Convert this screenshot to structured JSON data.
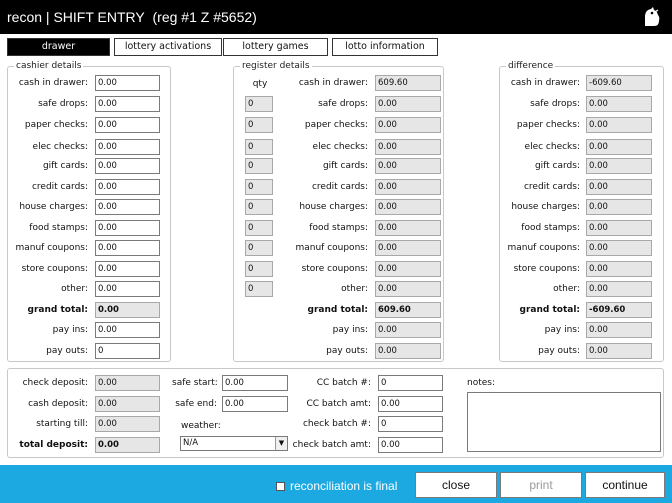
{
  "title": {
    "app": "recon",
    "sep": " | ",
    "screen": "SHIFT ENTRY",
    "reg": "(reg #1  Z #5652)",
    "logo_icon": "bird-logo"
  },
  "tabs": [
    "drawer",
    "lottery activations",
    "lottery games",
    "lotto information"
  ],
  "rows": [
    "cash in drawer:",
    "safe drops:",
    "paper checks:",
    "elec checks:",
    "gift cards:",
    "credit cards:",
    "house charges:",
    "food stamps:",
    "manuf coupons:",
    "store coupons:",
    "other:",
    "grand total:",
    "pay ins:",
    "pay outs:"
  ],
  "cashier": {
    "legend": "cashier details",
    "values": [
      "0.00",
      "0.00",
      "0.00",
      "0.00",
      "0.00",
      "0.00",
      "0.00",
      "0.00",
      "0.00",
      "0.00",
      "0.00",
      "0.00",
      "0.00",
      "0"
    ]
  },
  "register": {
    "legend": "register details",
    "qty_header": "qty",
    "qty": [
      "0",
      "0",
      "0",
      "0",
      "0",
      "0",
      "0",
      "0",
      "0",
      "0"
    ],
    "values": [
      "609.60",
      "0.00",
      "0.00",
      "0.00",
      "0.00",
      "0.00",
      "0.00",
      "0.00",
      "0.00",
      "0.00",
      "0.00",
      "609.60",
      "0.00",
      "0.00"
    ]
  },
  "difference": {
    "legend": "difference",
    "values": [
      "-609.60",
      "0.00",
      "0.00",
      "0.00",
      "0.00",
      "0.00",
      "0.00",
      "0.00",
      "0.00",
      "0.00",
      "0.00",
      "-609.60",
      "0.00",
      "0.00"
    ]
  },
  "bottom": {
    "deposit_labels": [
      "check deposit:",
      "cash deposit:",
      "starting till:",
      "total deposit:"
    ],
    "deposit_values": [
      "0.00",
      "0.00",
      "0.00",
      "0.00"
    ],
    "safe_start_label": "safe start:",
    "safe_start_value": "0.00",
    "safe_end_label": "safe end:",
    "safe_end_value": "0.00",
    "weather_label": "weather:",
    "weather_value": "N/A",
    "batch_labels": [
      "CC batch #:",
      "CC batch amt:",
      "check batch #:",
      "check batch amt:"
    ],
    "batch_values": [
      "0",
      "0.00",
      "0",
      "0.00"
    ],
    "notes_label": "notes:"
  },
  "footer": {
    "final_label": "reconciliation is final",
    "close": "close",
    "print": "print",
    "continue": "continue"
  },
  "colors": {
    "titlebar": "#000000",
    "footer": "#1ca8e0",
    "readonly": "#e6e6e6"
  }
}
